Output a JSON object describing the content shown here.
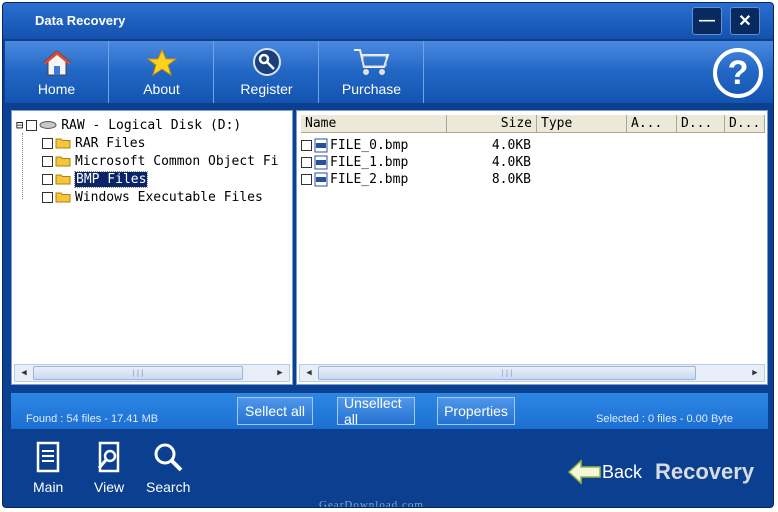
{
  "window": {
    "title": "Data Recovery",
    "minimize_label": "—",
    "close_label": "✕"
  },
  "toolbar": {
    "items": [
      {
        "label": "Home",
        "icon": "home-icon"
      },
      {
        "label": "About",
        "icon": "star-icon"
      },
      {
        "label": "Register",
        "icon": "key-icon"
      },
      {
        "label": "Purchase",
        "icon": "cart-icon"
      }
    ],
    "help_label": "?"
  },
  "tree": {
    "root": {
      "label": "RAW - Logical Disk (D:)",
      "expander": "⊟"
    },
    "children": [
      {
        "label": "RAR Files"
      },
      {
        "label": "Microsoft Common Object Fi"
      },
      {
        "label": "BMP Files",
        "selected": true
      },
      {
        "label": "Windows Executable Files"
      }
    ]
  },
  "file_list": {
    "columns": [
      "Name",
      "Size",
      "Type",
      "A...",
      "D...",
      "D..."
    ],
    "rows": [
      {
        "name": "FILE_0.bmp",
        "size": "4.0KB"
      },
      {
        "name": "FILE_1.bmp",
        "size": "4.0KB"
      },
      {
        "name": "FILE_2.bmp",
        "size": "8.0KB"
      }
    ]
  },
  "scrollbar": {
    "left_arrow": "◀",
    "right_arrow": "▶",
    "grip": "|||"
  },
  "status": {
    "found": "Found : 54 files - 17.41 MB",
    "selected": "Selected : 0 files - 0.00 Byte",
    "select_all": "Sellect all",
    "unselect_all": "Unsellect all",
    "properties": "Properties"
  },
  "bottom": {
    "items": [
      {
        "label": "Main",
        "icon": "document-icon"
      },
      {
        "label": "View",
        "icon": "magnifier-document-icon"
      },
      {
        "label": "Search",
        "icon": "search-icon"
      }
    ],
    "back_label": "Back",
    "recovery_label": "Recovery",
    "watermark": "GearDownload.com"
  },
  "colors": {
    "frame": "#0b3f8f",
    "toolbar": "#2266c4",
    "selection": "#0a246a",
    "folder": "#f5c542"
  }
}
